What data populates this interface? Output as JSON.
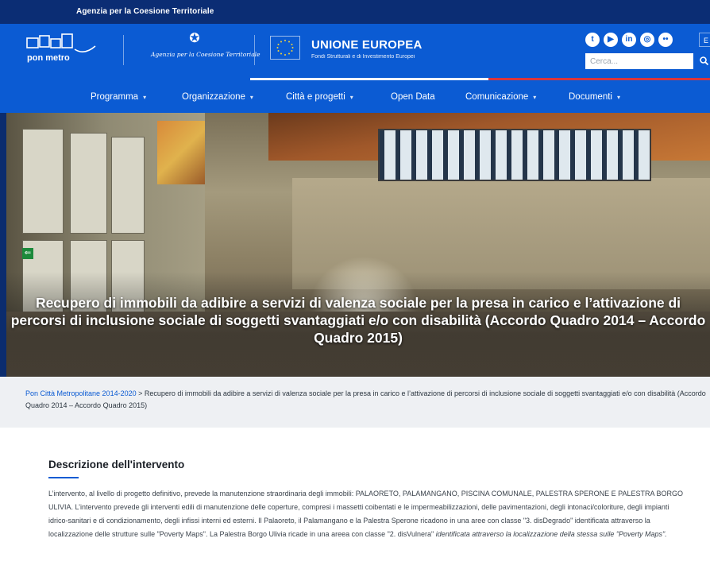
{
  "topbar": {
    "agency_text": "Agenzia per la Coesione Territoriale"
  },
  "brand": {
    "logo_text": "pon metro",
    "agency_script": "Agenzia per la Coesione Territoriale",
    "eu_title": "UNIONE EUROPEA",
    "eu_subtitle": "Fondi Strutturali e di Investimento Europei",
    "lang_label": "E",
    "search_placeholder": "Cerca..."
  },
  "social": [
    {
      "name": "twitter-icon",
      "glyph": "t"
    },
    {
      "name": "youtube-icon",
      "glyph": "▶"
    },
    {
      "name": "linkedin-icon",
      "glyph": "in"
    },
    {
      "name": "instagram-icon",
      "glyph": "◎"
    },
    {
      "name": "flickr-icon",
      "glyph": "••"
    }
  ],
  "nav": {
    "items": [
      {
        "label": "Programma",
        "has_menu": true
      },
      {
        "label": "Organizzazione",
        "has_menu": true
      },
      {
        "label": "Città e progetti",
        "has_menu": true
      },
      {
        "label": "Open Data",
        "has_menu": false
      },
      {
        "label": "Comunicazione",
        "has_menu": true
      },
      {
        "label": "Documenti",
        "has_menu": true
      }
    ],
    "caret": "▾"
  },
  "hero": {
    "title": "Recupero di immobili da adibire a servizi di valenza sociale per la presa in carico e l’attivazione di percorsi di inclusione sociale di soggetti svantaggiati e/o con disabilità (Accordo Quadro 2014 – Accordo Quadro 2015)"
  },
  "breadcrumb": {
    "home": "Pon Città Metropolitane 2014-2020",
    "separator": " > ",
    "current": "Recupero di immobili da adibire a servizi di valenza sociale per la presa in carico e l’attivazione di percorsi di inclusione sociale di soggetti svantaggiati e/o con disabilità (Accordo Quadro 2014 – Accordo Quadro 2015)"
  },
  "content": {
    "section_title": "Descrizione dell'intervento",
    "paragraph": "L’intervento, al livello di progetto definitivo, prevede la manutenzione straordinaria degli immobili: PALAORETO, PALAMANGANO, PISCINA COMUNALE, PALESTRA SPERONE E PALESTRA BORGO ULIVIA. L’intervento prevede gli interventi edili di manutenzione delle coperture, compresi i massetti coibentati e le impermeabilizzazioni, delle pavimentazioni, degli intonaci/coloriture, degli impianti idrico-sanitari e di condizionamento, degli infissi interni ed esterni. Il Palaoreto, il Palamangano e la Palestra Sperone ricadono in una aree con classe \"3. disDegrado\" identificata attraverso la localizzazione delle strutture sulle \"Poverty Maps\". La Palestra Borgo Ulivia ricade in una areea con classe \"2. disVulnera\"",
    "paragraph_italic": " identificata attraverso la localizzazione della stessa sulle \"Poverty Maps\"."
  },
  "colors": {
    "topbar": "#0b2d74",
    "brand_blue": "#0b5bd3",
    "nav_accent_white": "#ffffff",
    "nav_accent_red": "#d9363e",
    "breadcrumb_bg": "#eef0f3"
  }
}
